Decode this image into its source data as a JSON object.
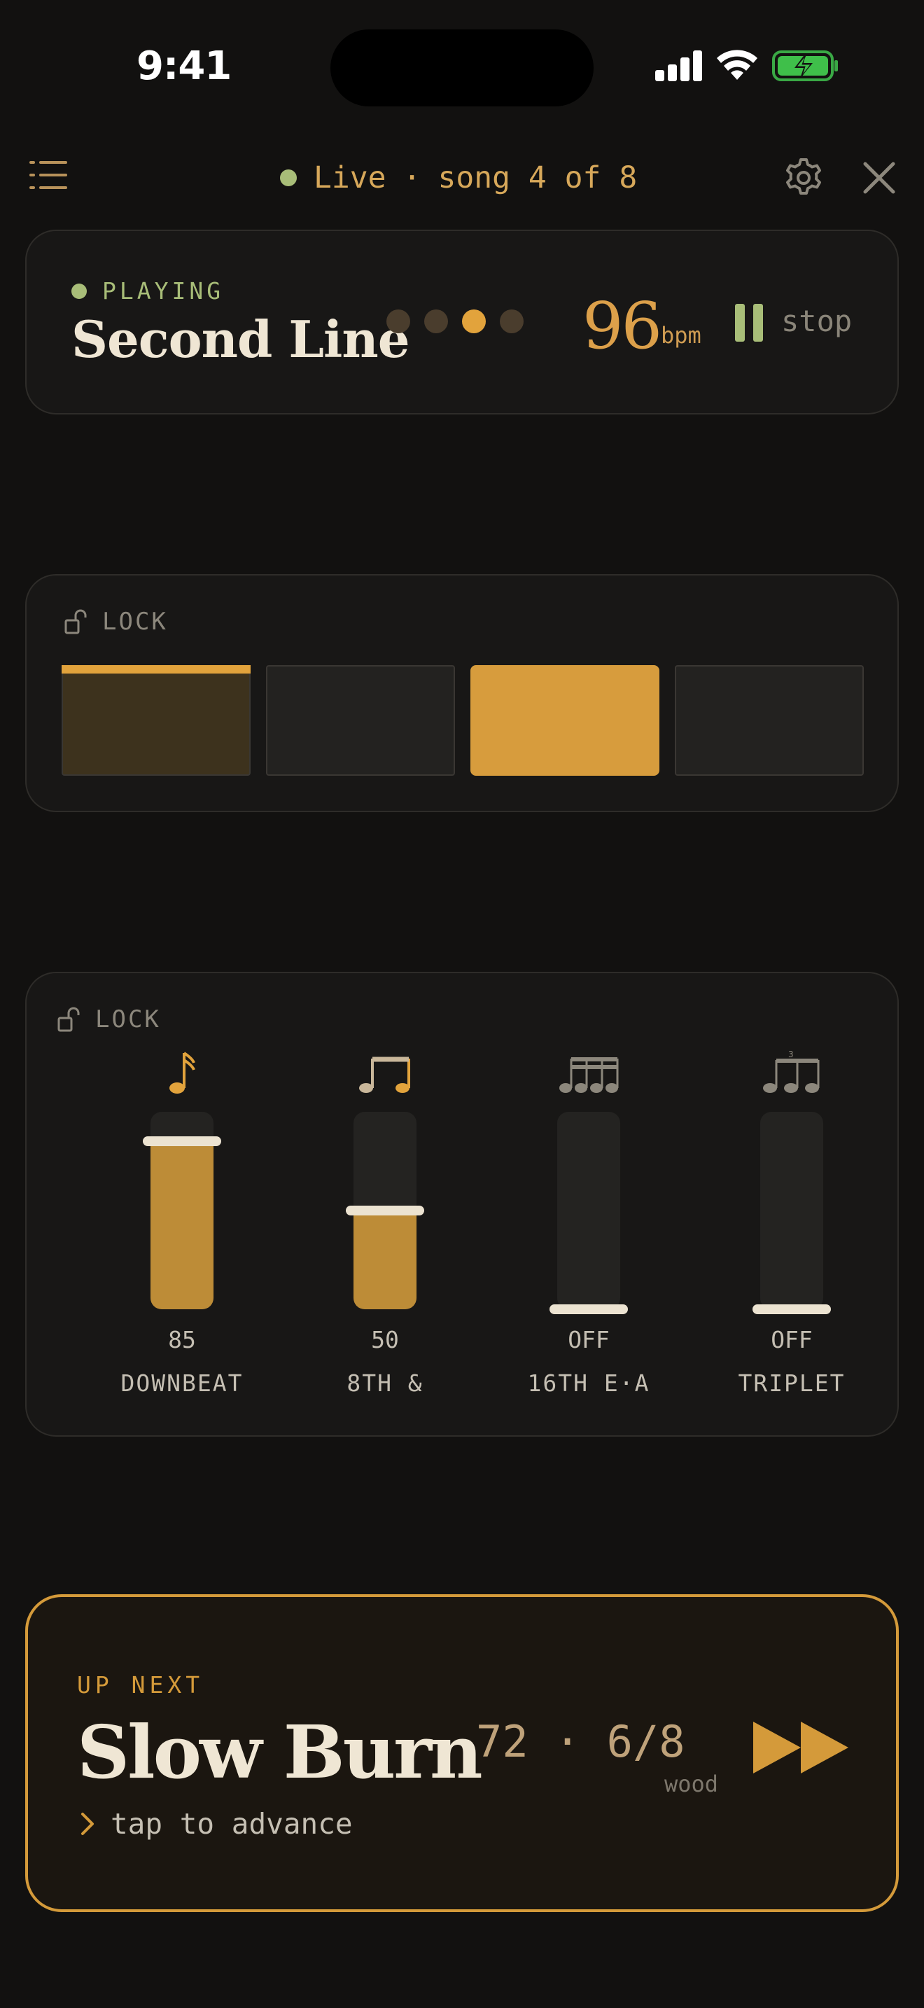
{
  "status_bar": {
    "time": "9:41"
  },
  "header": {
    "live_label": "Live",
    "separator": "·",
    "song_position": "song 4 of 8"
  },
  "now_playing": {
    "state": "PLAYING",
    "title": "Second Line",
    "beats": [
      false,
      false,
      true,
      false
    ],
    "bpm": "96",
    "bpm_unit": "bpm",
    "stop_label": "stop"
  },
  "pattern": {
    "lock_label": "LOCK",
    "cells": [
      "accent",
      "off",
      "active",
      "off"
    ]
  },
  "levels": {
    "lock_label": "LOCK",
    "channels": [
      {
        "value": "85",
        "label": "DOWNBEAT",
        "level": 0.85,
        "icon": "quarter-note-icon"
      },
      {
        "value": "50",
        "label": "8TH &",
        "level": 0.5,
        "icon": "eighth-notes-icon"
      },
      {
        "value": "OFF",
        "label": "16TH E·A",
        "level": 0,
        "icon": "sixteenth-notes-icon"
      },
      {
        "value": "OFF",
        "label": "TRIPLET",
        "level": 0,
        "icon": "triplet-notes-icon"
      }
    ]
  },
  "up_next": {
    "kicker": "UP NEXT",
    "title": "Slow Burn",
    "action": "tap to advance",
    "meta": "72 · 6/8",
    "sound": "wood"
  },
  "colors": {
    "accent": "#e2a33c",
    "playing": "#a8bd78",
    "background": "#121110"
  }
}
